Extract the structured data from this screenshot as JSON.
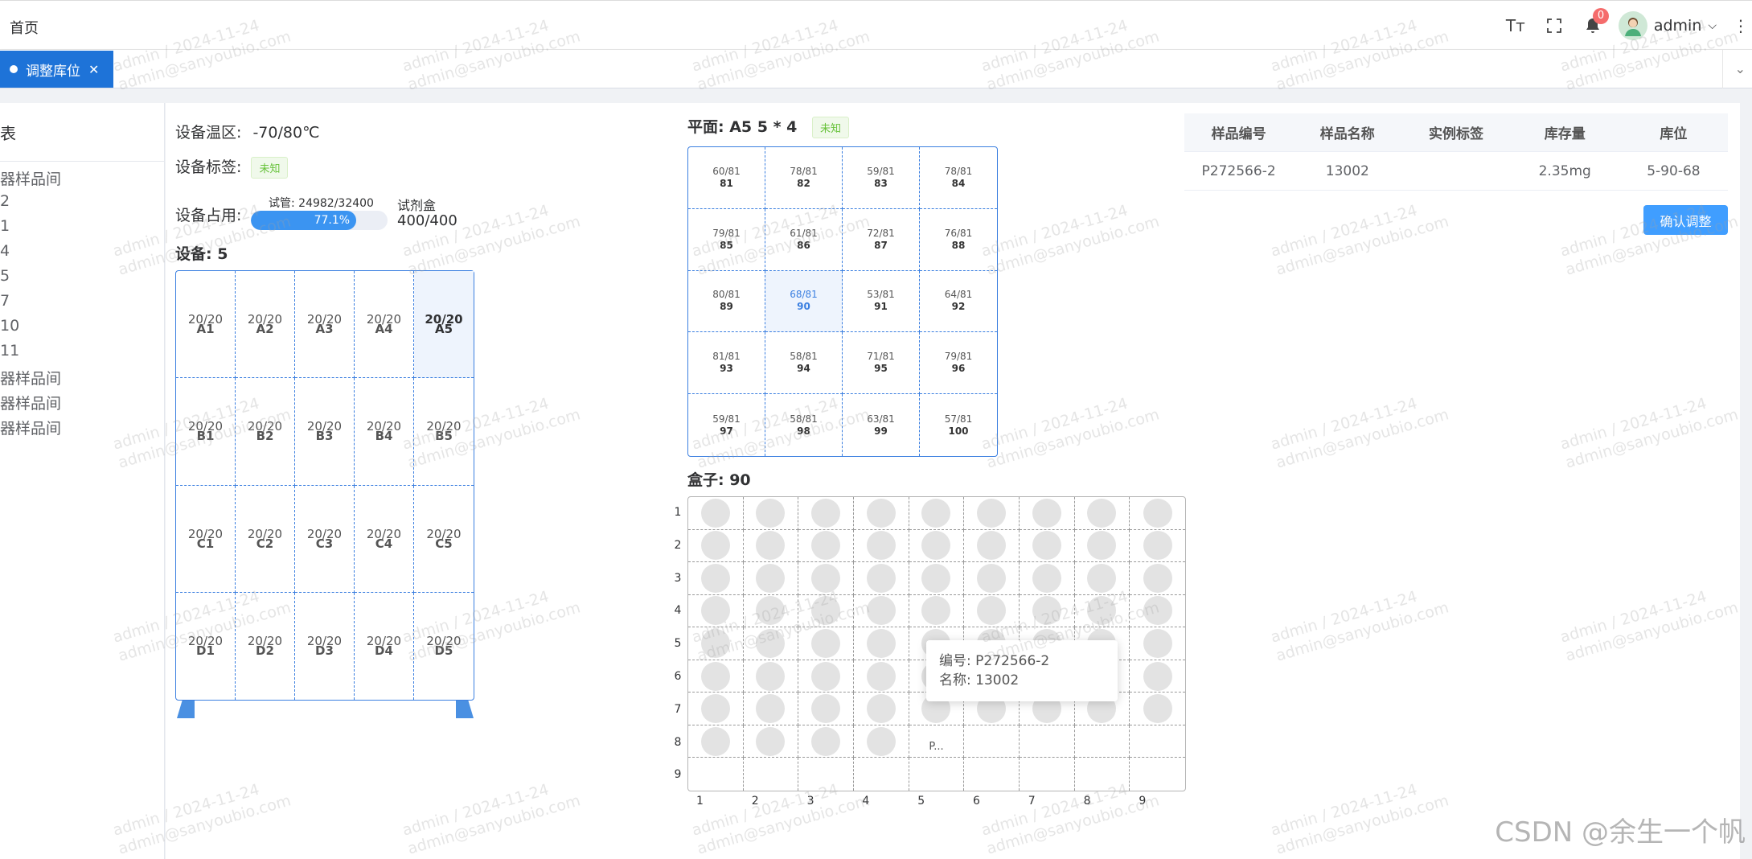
{
  "header": {
    "home": "首页",
    "font_icon": "Tт",
    "notif_count": "0",
    "user": "admin"
  },
  "tags": {
    "active": "调整库位"
  },
  "left_panel": {
    "title": "表",
    "items": [
      "器样品间",
      "2",
      "1",
      "4",
      "5",
      "7",
      "10",
      "11",
      "器样品间",
      "器样品间",
      "器样品间"
    ]
  },
  "device": {
    "temp_label": "设备温区:",
    "temp_value": "-70/80℃",
    "tag_label": "设备标签:",
    "tag_value": "未知",
    "usage_label": "设备占用:",
    "tube_text": "试管: 24982/32400",
    "progress_text": "77.1%",
    "progress": 0.771,
    "kit_label": "试剂盒",
    "kit_value": "400/400",
    "title": "设备: 5",
    "cells": [
      {
        "n": "20/20",
        "c": "A1"
      },
      {
        "n": "20/20",
        "c": "A2"
      },
      {
        "n": "20/20",
        "c": "A3"
      },
      {
        "n": "20/20",
        "c": "A4"
      },
      {
        "n": "20/20",
        "c": "A5"
      },
      {
        "n": "20/20",
        "c": "B1"
      },
      {
        "n": "20/20",
        "c": "B2"
      },
      {
        "n": "20/20",
        "c": "B3"
      },
      {
        "n": "20/20",
        "c": "B4"
      },
      {
        "n": "20/20",
        "c": "B5"
      },
      {
        "n": "20/20",
        "c": "C1"
      },
      {
        "n": "20/20",
        "c": "C2"
      },
      {
        "n": "20/20",
        "c": "C3"
      },
      {
        "n": "20/20",
        "c": "C4"
      },
      {
        "n": "20/20",
        "c": "C5"
      },
      {
        "n": "20/20",
        "c": "D1"
      },
      {
        "n": "20/20",
        "c": "D2"
      },
      {
        "n": "20/20",
        "c": "D3"
      },
      {
        "n": "20/20",
        "c": "D4"
      },
      {
        "n": "20/20",
        "c": "D5"
      }
    ],
    "selected": "A5"
  },
  "plane": {
    "title": "平面: A5 5 * 4",
    "tag": "未知",
    "cells": [
      {
        "n": "60/81",
        "c": "81"
      },
      {
        "n": "78/81",
        "c": "82"
      },
      {
        "n": "59/81",
        "c": "83"
      },
      {
        "n": "78/81",
        "c": "84"
      },
      {
        "n": "79/81",
        "c": "85"
      },
      {
        "n": "61/81",
        "c": "86"
      },
      {
        "n": "72/81",
        "c": "87"
      },
      {
        "n": "76/81",
        "c": "88"
      },
      {
        "n": "80/81",
        "c": "89"
      },
      {
        "n": "68/81",
        "c": "90"
      },
      {
        "n": "53/81",
        "c": "91"
      },
      {
        "n": "64/81",
        "c": "92"
      },
      {
        "n": "81/81",
        "c": "93"
      },
      {
        "n": "58/81",
        "c": "94"
      },
      {
        "n": "71/81",
        "c": "95"
      },
      {
        "n": "79/81",
        "c": "96"
      },
      {
        "n": "59/81",
        "c": "97"
      },
      {
        "n": "58/81",
        "c": "98"
      },
      {
        "n": "63/81",
        "c": "99"
      },
      {
        "n": "57/81",
        "c": "100"
      }
    ],
    "selected": "90"
  },
  "box": {
    "title": "盒子: 90",
    "rows": [
      "1",
      "2",
      "3",
      "4",
      "5",
      "6",
      "7",
      "8",
      "9"
    ],
    "cols": [
      "1",
      "2",
      "3",
      "4",
      "5",
      "6",
      "7",
      "8",
      "9"
    ],
    "placeholder_text": "P...",
    "tooltip_id": "编号: P272566-2",
    "tooltip_name": "名称: 13002"
  },
  "table": {
    "headers": [
      "样品编号",
      "样品名称",
      "实例标签",
      "库存量",
      "库位"
    ],
    "rows": [
      [
        "P272566-2",
        "13002",
        "",
        "2.35mg",
        "5-90-68"
      ]
    ]
  },
  "confirm_button": "确认调整",
  "watermark_line1": "admin / 2024-11-24",
  "watermark_line2": "admin@sanyoubio.com",
  "csdn_mark": "CSDN @余生一个帆"
}
